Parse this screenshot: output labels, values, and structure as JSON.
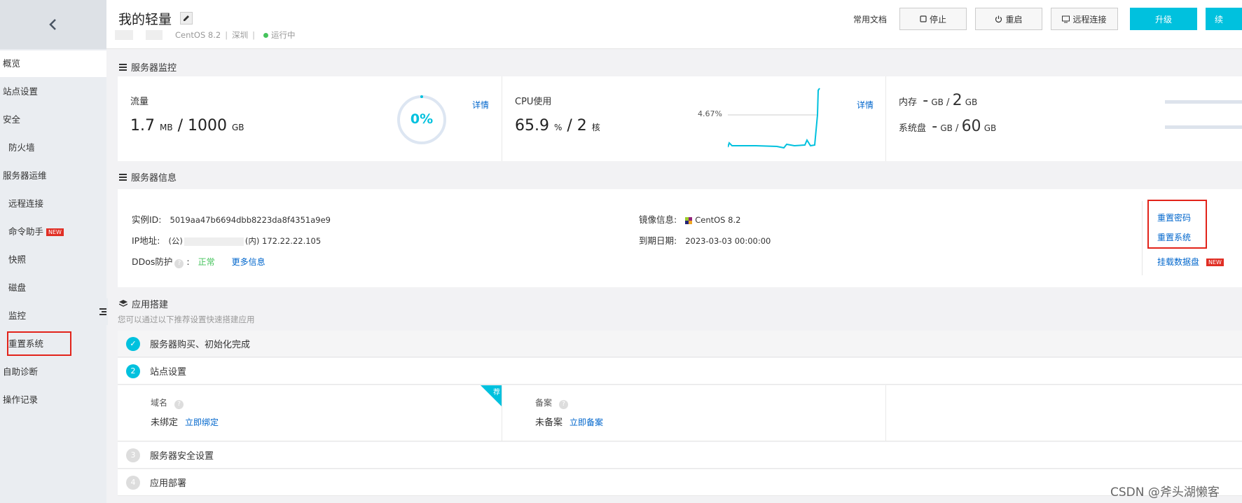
{
  "sidebar": {
    "items": [
      {
        "label": "概览"
      },
      {
        "label": "站点设置"
      },
      {
        "label": "安全"
      },
      {
        "label": "防火墙"
      },
      {
        "label": "服务器运维"
      },
      {
        "label": "远程连接"
      },
      {
        "label": "命令助手",
        "badge": "NEW"
      },
      {
        "label": "快照"
      },
      {
        "label": "磁盘"
      },
      {
        "label": "监控"
      },
      {
        "label": "重置系统"
      },
      {
        "label": "自助诊断"
      },
      {
        "label": "操作记录"
      }
    ]
  },
  "header": {
    "title": "我的轻量",
    "os": "CentOS 8.2",
    "region": "深圳",
    "status": "运行中",
    "docs_label": "常用文档",
    "buttons": {
      "stop": "停止",
      "restart": "重启",
      "remote": "远程连接",
      "upgrade": "升级",
      "renew": "续"
    }
  },
  "monitor": {
    "title": "服务器监控",
    "traffic": {
      "label": "流量",
      "used": "1.7",
      "used_unit": "MB",
      "total": "1000",
      "total_unit": "GB",
      "percent": "0%",
      "detail": "详情"
    },
    "cpu": {
      "label": "CPU使用",
      "value": "65.9",
      "unit": "%",
      "cores": "2",
      "cores_unit": "核",
      "peak_label": "4.67%",
      "detail": "详情"
    },
    "memory": {
      "label": "内存",
      "used": "-",
      "used_unit": "GB",
      "total": "2",
      "total_unit": "GB"
    },
    "disk": {
      "label": "系统盘",
      "used": "-",
      "used_unit": "GB",
      "total": "60",
      "total_unit": "GB"
    }
  },
  "info": {
    "title": "服务器信息",
    "instance_id_label": "实例ID:",
    "instance_id": "5019aa47b6694dbb8223da8f4351a9e9",
    "ip_label": "IP地址:",
    "ip_public_prefix": "(公)",
    "ip_private": "(内) 172.22.22.105",
    "ddos_label": "DDos防护",
    "ddos_status": "正常",
    "ddos_more": "更多信息",
    "image_label": "镜像信息:",
    "image_value": "CentOS 8.2",
    "expire_label": "到期日期:",
    "expire_value": "2023-03-03 00:00:00",
    "actions": {
      "reset_password": "重置密码",
      "reset_system": "重置系统",
      "mount_disk": "挂载数据盘",
      "mount_badge": "NEW"
    }
  },
  "apps": {
    "title": "应用搭建",
    "desc": "您可以通过以下推荐设置快速搭建应用",
    "steps": [
      {
        "num": "✓",
        "label": "服务器购买、初始化完成"
      },
      {
        "num": "2",
        "label": "站点设置"
      },
      {
        "num": "3",
        "label": "服务器安全设置"
      },
      {
        "num": "4",
        "label": "应用部署"
      }
    ],
    "domain": {
      "label": "域名",
      "status": "未绑定",
      "action": "立即绑定",
      "corner": "荐"
    },
    "icp": {
      "label": "备案",
      "status": "未备案",
      "action": "立即备案"
    }
  },
  "watermark": "CSDN @斧头湖懒客"
}
